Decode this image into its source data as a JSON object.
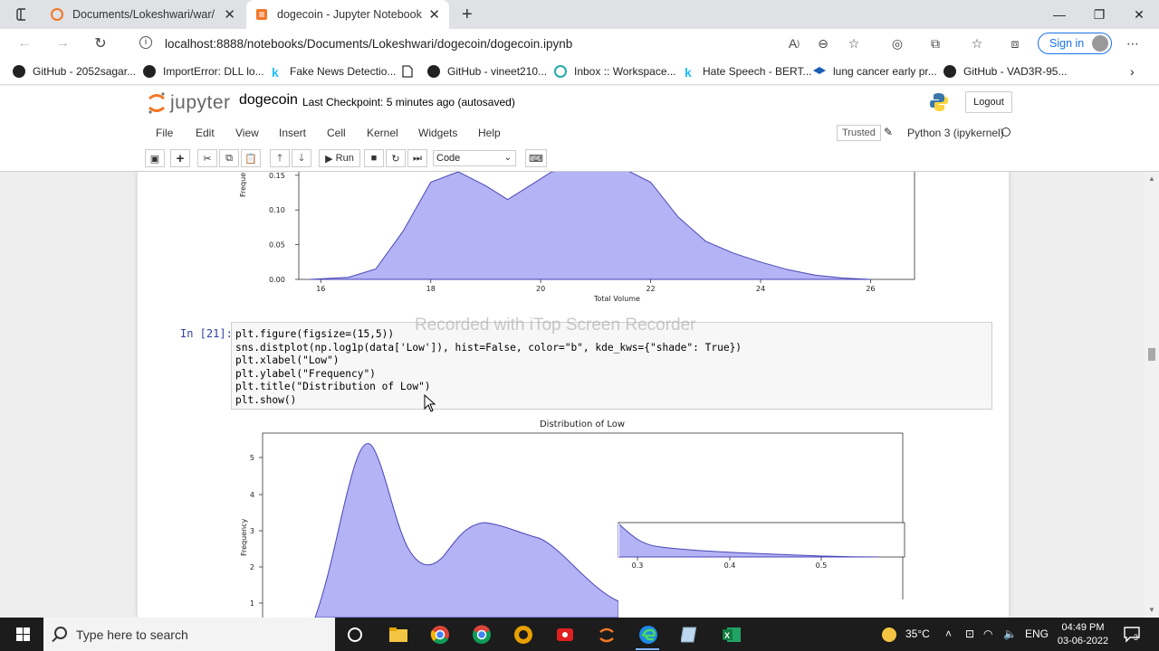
{
  "browser": {
    "tabs": [
      {
        "title": "Documents/Lokeshwari/war/",
        "active": false
      },
      {
        "title": "dogecoin - Jupyter Notebook",
        "active": true
      }
    ],
    "url": "localhost:8888/notebooks/Documents/Lokeshwari/dogecoin/dogecoin.ipynb",
    "sign_in": "Sign in",
    "bookmarks": [
      "GitHub - 2052sagar...",
      "ImportError: DLL lo...",
      "Fake News Detectio...",
      "GitHub - vineet210...",
      "Inbox :: Workspace...",
      "Hate Speech - BERT...",
      "lung cancer early pr...",
      "GitHub - VAD3R-95..."
    ]
  },
  "jupyter": {
    "logo_text": "jupyter",
    "notebook_name": "dogecoin",
    "checkpoint": "Last Checkpoint: 5 minutes ago",
    "autosaved": "(autosaved)",
    "logout": "Logout",
    "menu": [
      "File",
      "Edit",
      "View",
      "Insert",
      "Cell",
      "Kernel",
      "Widgets",
      "Help"
    ],
    "trusted": "Trusted",
    "kernel": "Python 3 (ipykernel)",
    "run_label": "Run",
    "cell_type": "Code"
  },
  "cell": {
    "prompt": "In [21]:",
    "code_lines": [
      "plt.figure(figsize=(15,5))",
      "sns.distplot(np.log1p(data['Low']), hist=False, color=\"b\", kde_kws={\"shade\": True})",
      "plt.xlabel(\"Low\")",
      "plt.ylabel(\"Frequency\")",
      "plt.title(\"Distribution of Low\")",
      "plt.show()"
    ]
  },
  "watermark": "Recorded with iTop Screen Recorder",
  "chart_data": [
    {
      "type": "area",
      "title": "",
      "xlabel": "Total Volume",
      "ylabel": "Freque",
      "xticks": [
        "16",
        "18",
        "20",
        "22",
        "24",
        "26"
      ],
      "yticks": [
        "0.00",
        "0.05",
        "0.10",
        "0.15"
      ],
      "xlim": [
        15.6,
        26.8
      ],
      "ylim": [
        0,
        0.155
      ],
      "x": [
        15.8,
        16.5,
        17,
        17.5,
        18,
        18.5,
        19,
        19.4,
        19.8,
        20.2,
        20.8,
        21.5,
        22,
        22.5,
        23,
        23.5,
        24,
        24.5,
        25,
        25.5,
        26
      ],
      "y": [
        0,
        0.003,
        0.015,
        0.07,
        0.14,
        0.155,
        0.135,
        0.115,
        0.135,
        0.155,
        0.16,
        0.16,
        0.14,
        0.09,
        0.055,
        0.038,
        0.025,
        0.014,
        0.006,
        0.002,
        0
      ],
      "color": "#b3b3f5"
    },
    {
      "type": "area",
      "title": "Distribution of Low",
      "xlabel": "",
      "ylabel": "Frequency",
      "xticks": [
        "0.3",
        "0.4",
        "0.5"
      ],
      "yticks": [
        "1",
        "2",
        "3",
        "4",
        "5"
      ],
      "color": "#b3b3f5"
    }
  ],
  "taskbar": {
    "search_placeholder": "Type here to search",
    "temperature": "35°C",
    "language": "ENG",
    "time": "04:49 PM",
    "date": "03-06-2022",
    "notifications": "3"
  }
}
